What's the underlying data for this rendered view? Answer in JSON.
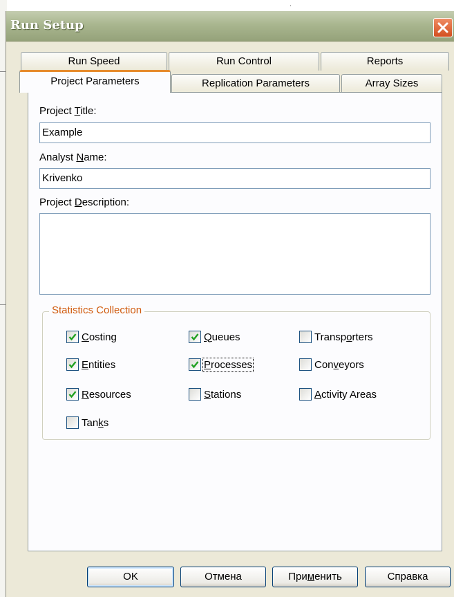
{
  "window": {
    "title": "Run Setup"
  },
  "tabs": {
    "back": [
      {
        "label": "Run Speed"
      },
      {
        "label": "Run Control"
      },
      {
        "label": "Reports"
      }
    ],
    "front": [
      {
        "label": "Project Parameters",
        "active": true
      },
      {
        "label": "Replication Parameters",
        "active": false
      },
      {
        "label": "Array Sizes",
        "active": false
      }
    ]
  },
  "form": {
    "project_title": {
      "label_pre": "Project ",
      "label_key": "T",
      "label_post": "itle:",
      "value": "Example"
    },
    "analyst_name": {
      "label_pre": "Analyst ",
      "label_key": "N",
      "label_post": "ame:",
      "value": "Krivenko"
    },
    "project_description": {
      "label_pre": "Project ",
      "label_key": "D",
      "label_post": "escription:",
      "value": ""
    }
  },
  "statistics": {
    "legend": "Statistics Collection",
    "items": {
      "costing": {
        "pre": "",
        "key": "C",
        "post": "osting",
        "checked": true
      },
      "entities": {
        "pre": "",
        "key": "E",
        "post": "ntities",
        "checked": true
      },
      "resources": {
        "pre": "",
        "key": "R",
        "post": "esources",
        "checked": true
      },
      "tanks": {
        "pre": "Tan",
        "key": "k",
        "post": "s",
        "checked": false
      },
      "queues": {
        "pre": "",
        "key": "Q",
        "post": "ueues",
        "checked": true
      },
      "processes": {
        "pre": "",
        "key": "P",
        "post": "rocesses",
        "checked": true
      },
      "stations": {
        "pre": "",
        "key": "S",
        "post": "tations",
        "checked": false
      },
      "transporters": {
        "pre": "Transp",
        "key": "o",
        "post": "rters",
        "checked": false
      },
      "conveyors": {
        "pre": "Con",
        "key": "v",
        "post": "eyors",
        "checked": false
      },
      "activity_areas": {
        "pre": "",
        "key": "A",
        "post": "ctivity Areas",
        "checked": false
      }
    }
  },
  "buttons": {
    "ok": "OK",
    "cancel": "Отмена",
    "apply_pre": "При",
    "apply_key": "м",
    "apply_post": "енить",
    "help": "Справка"
  },
  "colors": {
    "accent_tab": "#e68b2c",
    "group_legend": "#d05a0c",
    "checkmark": "#21a121",
    "close_button": "#d34f20"
  },
  "icons": {
    "close": "close-icon",
    "checkmark": "checkmark-icon"
  }
}
